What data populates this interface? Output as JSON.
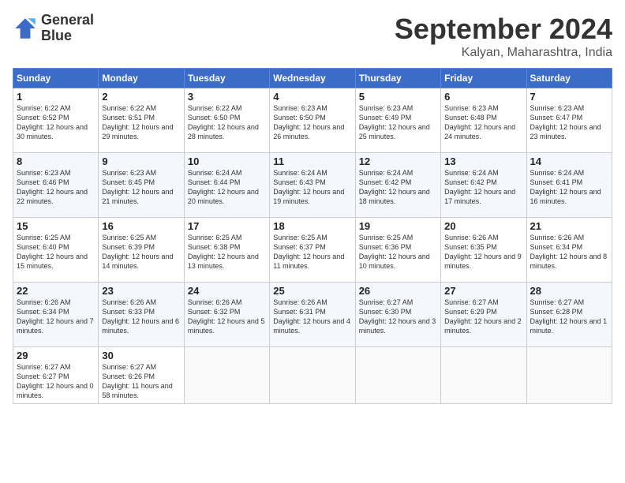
{
  "header": {
    "logo_line1": "General",
    "logo_line2": "Blue",
    "month": "September 2024",
    "location": "Kalyan, Maharashtra, India"
  },
  "weekdays": [
    "Sunday",
    "Monday",
    "Tuesday",
    "Wednesday",
    "Thursday",
    "Friday",
    "Saturday"
  ],
  "weeks": [
    [
      {
        "day": "1",
        "rise": "6:22 AM",
        "set": "6:52 PM",
        "daylight": "12 hours and 30 minutes."
      },
      {
        "day": "2",
        "rise": "6:22 AM",
        "set": "6:51 PM",
        "daylight": "12 hours and 29 minutes."
      },
      {
        "day": "3",
        "rise": "6:22 AM",
        "set": "6:50 PM",
        "daylight": "12 hours and 28 minutes."
      },
      {
        "day": "4",
        "rise": "6:23 AM",
        "set": "6:50 PM",
        "daylight": "12 hours and 26 minutes."
      },
      {
        "day": "5",
        "rise": "6:23 AM",
        "set": "6:49 PM",
        "daylight": "12 hours and 25 minutes."
      },
      {
        "day": "6",
        "rise": "6:23 AM",
        "set": "6:48 PM",
        "daylight": "12 hours and 24 minutes."
      },
      {
        "day": "7",
        "rise": "6:23 AM",
        "set": "6:47 PM",
        "daylight": "12 hours and 23 minutes."
      }
    ],
    [
      {
        "day": "8",
        "rise": "6:23 AM",
        "set": "6:46 PM",
        "daylight": "12 hours and 22 minutes."
      },
      {
        "day": "9",
        "rise": "6:23 AM",
        "set": "6:45 PM",
        "daylight": "12 hours and 21 minutes."
      },
      {
        "day": "10",
        "rise": "6:24 AM",
        "set": "6:44 PM",
        "daylight": "12 hours and 20 minutes."
      },
      {
        "day": "11",
        "rise": "6:24 AM",
        "set": "6:43 PM",
        "daylight": "12 hours and 19 minutes."
      },
      {
        "day": "12",
        "rise": "6:24 AM",
        "set": "6:42 PM",
        "daylight": "12 hours and 18 minutes."
      },
      {
        "day": "13",
        "rise": "6:24 AM",
        "set": "6:42 PM",
        "daylight": "12 hours and 17 minutes."
      },
      {
        "day": "14",
        "rise": "6:24 AM",
        "set": "6:41 PM",
        "daylight": "12 hours and 16 minutes."
      }
    ],
    [
      {
        "day": "15",
        "rise": "6:25 AM",
        "set": "6:40 PM",
        "daylight": "12 hours and 15 minutes."
      },
      {
        "day": "16",
        "rise": "6:25 AM",
        "set": "6:39 PM",
        "daylight": "12 hours and 14 minutes."
      },
      {
        "day": "17",
        "rise": "6:25 AM",
        "set": "6:38 PM",
        "daylight": "12 hours and 13 minutes."
      },
      {
        "day": "18",
        "rise": "6:25 AM",
        "set": "6:37 PM",
        "daylight": "12 hours and 11 minutes."
      },
      {
        "day": "19",
        "rise": "6:25 AM",
        "set": "6:36 PM",
        "daylight": "12 hours and 10 minutes."
      },
      {
        "day": "20",
        "rise": "6:26 AM",
        "set": "6:35 PM",
        "daylight": "12 hours and 9 minutes."
      },
      {
        "day": "21",
        "rise": "6:26 AM",
        "set": "6:34 PM",
        "daylight": "12 hours and 8 minutes."
      }
    ],
    [
      {
        "day": "22",
        "rise": "6:26 AM",
        "set": "6:34 PM",
        "daylight": "12 hours and 7 minutes."
      },
      {
        "day": "23",
        "rise": "6:26 AM",
        "set": "6:33 PM",
        "daylight": "12 hours and 6 minutes."
      },
      {
        "day": "24",
        "rise": "6:26 AM",
        "set": "6:32 PM",
        "daylight": "12 hours and 5 minutes."
      },
      {
        "day": "25",
        "rise": "6:26 AM",
        "set": "6:31 PM",
        "daylight": "12 hours and 4 minutes."
      },
      {
        "day": "26",
        "rise": "6:27 AM",
        "set": "6:30 PM",
        "daylight": "12 hours and 3 minutes."
      },
      {
        "day": "27",
        "rise": "6:27 AM",
        "set": "6:29 PM",
        "daylight": "12 hours and 2 minutes."
      },
      {
        "day": "28",
        "rise": "6:27 AM",
        "set": "6:28 PM",
        "daylight": "12 hours and 1 minute."
      }
    ],
    [
      {
        "day": "29",
        "rise": "6:27 AM",
        "set": "6:27 PM",
        "daylight": "12 hours and 0 minutes."
      },
      {
        "day": "30",
        "rise": "6:27 AM",
        "set": "6:26 PM",
        "daylight": "11 hours and 58 minutes."
      },
      null,
      null,
      null,
      null,
      null
    ]
  ]
}
